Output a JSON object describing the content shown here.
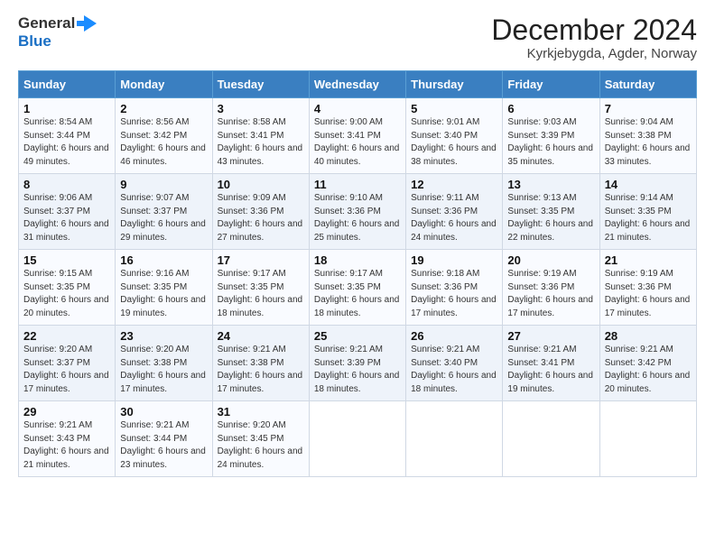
{
  "header": {
    "logo_line1": "General",
    "logo_line2": "Blue",
    "title": "December 2024",
    "subtitle": "Kyrkjebygda, Agder, Norway"
  },
  "columns": [
    "Sunday",
    "Monday",
    "Tuesday",
    "Wednesday",
    "Thursday",
    "Friday",
    "Saturday"
  ],
  "weeks": [
    [
      {
        "day": "1",
        "sunrise": "Sunrise: 8:54 AM",
        "sunset": "Sunset: 3:44 PM",
        "daylight": "Daylight: 6 hours and 49 minutes."
      },
      {
        "day": "2",
        "sunrise": "Sunrise: 8:56 AM",
        "sunset": "Sunset: 3:42 PM",
        "daylight": "Daylight: 6 hours and 46 minutes."
      },
      {
        "day": "3",
        "sunrise": "Sunrise: 8:58 AM",
        "sunset": "Sunset: 3:41 PM",
        "daylight": "Daylight: 6 hours and 43 minutes."
      },
      {
        "day": "4",
        "sunrise": "Sunrise: 9:00 AM",
        "sunset": "Sunset: 3:41 PM",
        "daylight": "Daylight: 6 hours and 40 minutes."
      },
      {
        "day": "5",
        "sunrise": "Sunrise: 9:01 AM",
        "sunset": "Sunset: 3:40 PM",
        "daylight": "Daylight: 6 hours and 38 minutes."
      },
      {
        "day": "6",
        "sunrise": "Sunrise: 9:03 AM",
        "sunset": "Sunset: 3:39 PM",
        "daylight": "Daylight: 6 hours and 35 minutes."
      },
      {
        "day": "7",
        "sunrise": "Sunrise: 9:04 AM",
        "sunset": "Sunset: 3:38 PM",
        "daylight": "Daylight: 6 hours and 33 minutes."
      }
    ],
    [
      {
        "day": "8",
        "sunrise": "Sunrise: 9:06 AM",
        "sunset": "Sunset: 3:37 PM",
        "daylight": "Daylight: 6 hours and 31 minutes."
      },
      {
        "day": "9",
        "sunrise": "Sunrise: 9:07 AM",
        "sunset": "Sunset: 3:37 PM",
        "daylight": "Daylight: 6 hours and 29 minutes."
      },
      {
        "day": "10",
        "sunrise": "Sunrise: 9:09 AM",
        "sunset": "Sunset: 3:36 PM",
        "daylight": "Daylight: 6 hours and 27 minutes."
      },
      {
        "day": "11",
        "sunrise": "Sunrise: 9:10 AM",
        "sunset": "Sunset: 3:36 PM",
        "daylight": "Daylight: 6 hours and 25 minutes."
      },
      {
        "day": "12",
        "sunrise": "Sunrise: 9:11 AM",
        "sunset": "Sunset: 3:36 PM",
        "daylight": "Daylight: 6 hours and 24 minutes."
      },
      {
        "day": "13",
        "sunrise": "Sunrise: 9:13 AM",
        "sunset": "Sunset: 3:35 PM",
        "daylight": "Daylight: 6 hours and 22 minutes."
      },
      {
        "day": "14",
        "sunrise": "Sunrise: 9:14 AM",
        "sunset": "Sunset: 3:35 PM",
        "daylight": "Daylight: 6 hours and 21 minutes."
      }
    ],
    [
      {
        "day": "15",
        "sunrise": "Sunrise: 9:15 AM",
        "sunset": "Sunset: 3:35 PM",
        "daylight": "Daylight: 6 hours and 20 minutes."
      },
      {
        "day": "16",
        "sunrise": "Sunrise: 9:16 AM",
        "sunset": "Sunset: 3:35 PM",
        "daylight": "Daylight: 6 hours and 19 minutes."
      },
      {
        "day": "17",
        "sunrise": "Sunrise: 9:17 AM",
        "sunset": "Sunset: 3:35 PM",
        "daylight": "Daylight: 6 hours and 18 minutes."
      },
      {
        "day": "18",
        "sunrise": "Sunrise: 9:17 AM",
        "sunset": "Sunset: 3:35 PM",
        "daylight": "Daylight: 6 hours and 18 minutes."
      },
      {
        "day": "19",
        "sunrise": "Sunrise: 9:18 AM",
        "sunset": "Sunset: 3:36 PM",
        "daylight": "Daylight: 6 hours and 17 minutes."
      },
      {
        "day": "20",
        "sunrise": "Sunrise: 9:19 AM",
        "sunset": "Sunset: 3:36 PM",
        "daylight": "Daylight: 6 hours and 17 minutes."
      },
      {
        "day": "21",
        "sunrise": "Sunrise: 9:19 AM",
        "sunset": "Sunset: 3:36 PM",
        "daylight": "Daylight: 6 hours and 17 minutes."
      }
    ],
    [
      {
        "day": "22",
        "sunrise": "Sunrise: 9:20 AM",
        "sunset": "Sunset: 3:37 PM",
        "daylight": "Daylight: 6 hours and 17 minutes."
      },
      {
        "day": "23",
        "sunrise": "Sunrise: 9:20 AM",
        "sunset": "Sunset: 3:38 PM",
        "daylight": "Daylight: 6 hours and 17 minutes."
      },
      {
        "day": "24",
        "sunrise": "Sunrise: 9:21 AM",
        "sunset": "Sunset: 3:38 PM",
        "daylight": "Daylight: 6 hours and 17 minutes."
      },
      {
        "day": "25",
        "sunrise": "Sunrise: 9:21 AM",
        "sunset": "Sunset: 3:39 PM",
        "daylight": "Daylight: 6 hours and 18 minutes."
      },
      {
        "day": "26",
        "sunrise": "Sunrise: 9:21 AM",
        "sunset": "Sunset: 3:40 PM",
        "daylight": "Daylight: 6 hours and 18 minutes."
      },
      {
        "day": "27",
        "sunrise": "Sunrise: 9:21 AM",
        "sunset": "Sunset: 3:41 PM",
        "daylight": "Daylight: 6 hours and 19 minutes."
      },
      {
        "day": "28",
        "sunrise": "Sunrise: 9:21 AM",
        "sunset": "Sunset: 3:42 PM",
        "daylight": "Daylight: 6 hours and 20 minutes."
      }
    ],
    [
      {
        "day": "29",
        "sunrise": "Sunrise: 9:21 AM",
        "sunset": "Sunset: 3:43 PM",
        "daylight": "Daylight: 6 hours and 21 minutes."
      },
      {
        "day": "30",
        "sunrise": "Sunrise: 9:21 AM",
        "sunset": "Sunset: 3:44 PM",
        "daylight": "Daylight: 6 hours and 23 minutes."
      },
      {
        "day": "31",
        "sunrise": "Sunrise: 9:20 AM",
        "sunset": "Sunset: 3:45 PM",
        "daylight": "Daylight: 6 hours and 24 minutes."
      },
      null,
      null,
      null,
      null
    ]
  ]
}
